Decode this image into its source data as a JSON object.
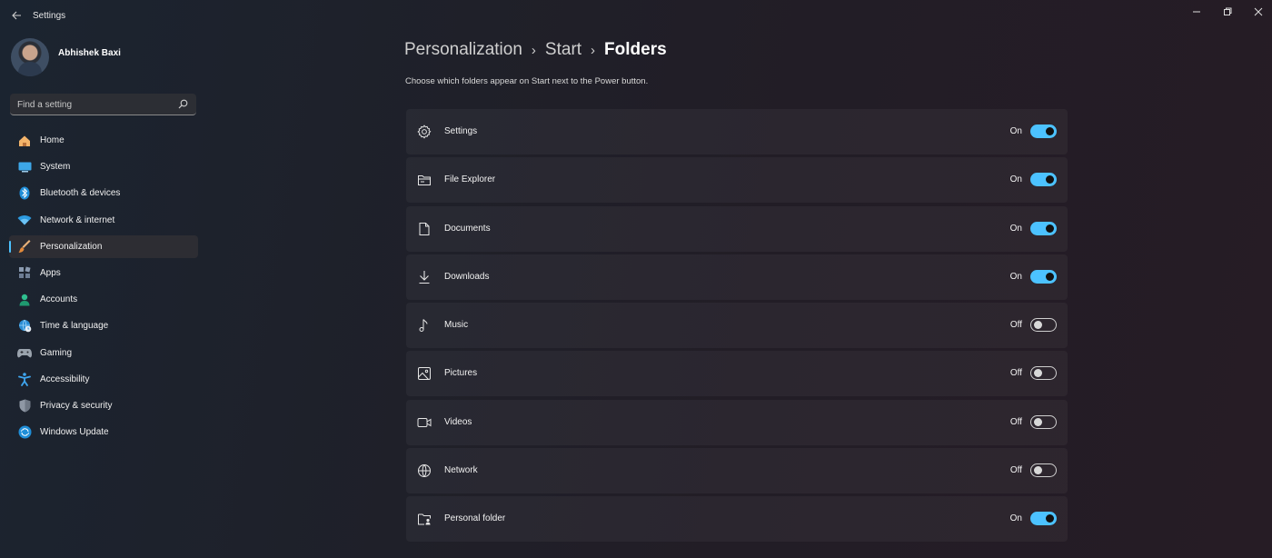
{
  "app": {
    "title": "Settings"
  },
  "user": {
    "name": "Abhishek Baxi"
  },
  "search": {
    "placeholder": "Find a setting"
  },
  "sidebar": {
    "items": [
      {
        "label": "Home",
        "icon": "home-icon",
        "active": false
      },
      {
        "label": "System",
        "icon": "system-icon",
        "active": false
      },
      {
        "label": "Bluetooth & devices",
        "icon": "bluetooth-icon",
        "active": false
      },
      {
        "label": "Network & internet",
        "icon": "wifi-icon",
        "active": false
      },
      {
        "label": "Personalization",
        "icon": "brush-icon",
        "active": true
      },
      {
        "label": "Apps",
        "icon": "apps-icon",
        "active": false
      },
      {
        "label": "Accounts",
        "icon": "accounts-icon",
        "active": false
      },
      {
        "label": "Time & language",
        "icon": "globe-clock-icon",
        "active": false
      },
      {
        "label": "Gaming",
        "icon": "gamepad-icon",
        "active": false
      },
      {
        "label": "Accessibility",
        "icon": "accessibility-icon",
        "active": false
      },
      {
        "label": "Privacy & security",
        "icon": "shield-icon",
        "active": false
      },
      {
        "label": "Windows Update",
        "icon": "update-icon",
        "active": false
      }
    ]
  },
  "breadcrumb": {
    "items": [
      "Personalization",
      "Start",
      "Folders"
    ]
  },
  "main": {
    "subtitle": "Choose which folders appear on Start next to the Power button.",
    "folders": [
      {
        "label": "Settings",
        "icon": "gear-icon",
        "state": "On"
      },
      {
        "label": "File Explorer",
        "icon": "file-explorer-icon",
        "state": "On"
      },
      {
        "label": "Documents",
        "icon": "document-icon",
        "state": "On"
      },
      {
        "label": "Downloads",
        "icon": "download-icon",
        "state": "On"
      },
      {
        "label": "Music",
        "icon": "music-icon",
        "state": "Off"
      },
      {
        "label": "Pictures",
        "icon": "picture-icon",
        "state": "Off"
      },
      {
        "label": "Videos",
        "icon": "video-icon",
        "state": "Off"
      },
      {
        "label": "Network",
        "icon": "network-globe-icon",
        "state": "Off"
      },
      {
        "label": "Personal folder",
        "icon": "personal-folder-icon",
        "state": "On"
      }
    ]
  },
  "colors": {
    "accent": "#4cc2ff"
  }
}
